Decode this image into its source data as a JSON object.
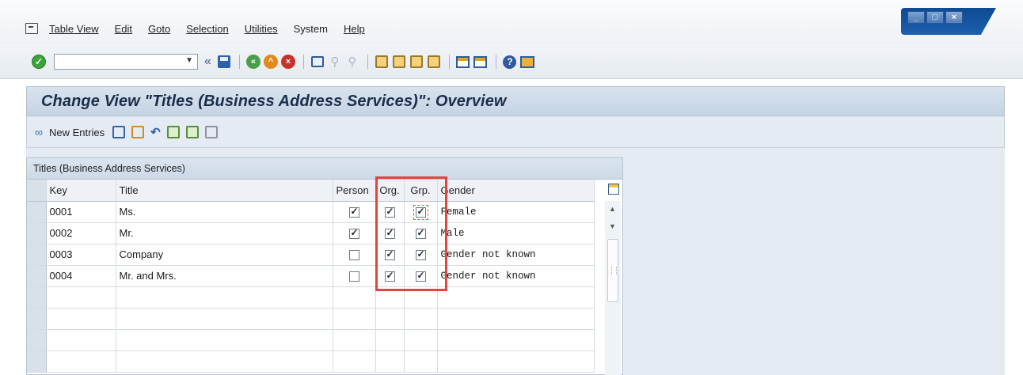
{
  "menu": {
    "items": [
      {
        "label": "Table View"
      },
      {
        "label": "Edit"
      },
      {
        "label": "Goto"
      },
      {
        "label": "Selection"
      },
      {
        "label": "Utilities"
      },
      {
        "label": "System"
      },
      {
        "label": "Help"
      }
    ]
  },
  "window_controls": {
    "minimize": "_",
    "maximize": "□",
    "close": "×"
  },
  "toolbar": {
    "command_value": "",
    "icons": [
      "enter-icon",
      "command-field",
      "collapse-icon",
      "save-icon",
      "back-icon",
      "exit-icon",
      "cancel-icon",
      "print-icon",
      "find-icon",
      "find-next-icon",
      "first-page-icon",
      "previous-page-icon",
      "next-page-icon",
      "last-page-icon",
      "create-session-icon",
      "shortcut-icon",
      "help-icon",
      "customize-layout-icon"
    ]
  },
  "title": "Change View \"Titles (Business Address Services)\": Overview",
  "app_toolbar": {
    "new_entries_label": "New Entries",
    "icons": [
      "display-change-icon",
      "copy-as-icon",
      "delete-icon",
      "undo-change-icon",
      "select-all-icon",
      "select-block-icon",
      "deselect-all-icon"
    ]
  },
  "table": {
    "caption": "Titles (Business Address Services)",
    "columns": [
      "Key",
      "Title",
      "Person",
      "Org.",
      "Grp.",
      "Gender"
    ],
    "rows": [
      {
        "key": "0001",
        "title": "Ms.",
        "person": true,
        "org": true,
        "grp": true,
        "gender": "Female"
      },
      {
        "key": "0002",
        "title": "Mr.",
        "person": true,
        "org": true,
        "grp": true,
        "gender": "Male"
      },
      {
        "key": "0003",
        "title": "Company",
        "person": false,
        "org": true,
        "grp": true,
        "gender": "Gender not known"
      },
      {
        "key": "0004",
        "title": "Mr. and Mrs.",
        "person": false,
        "org": true,
        "grp": true,
        "gender": "Gender not known"
      }
    ],
    "empty_rows": 4
  },
  "colors": {
    "accent": "#2e5c9a",
    "highlight": "#e0453f",
    "header_bg": "#d9e3ef"
  }
}
